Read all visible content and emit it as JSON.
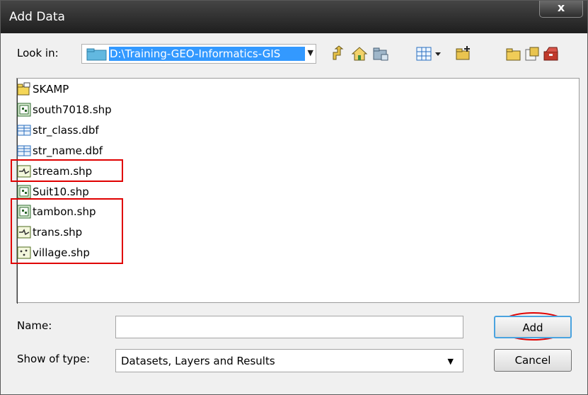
{
  "window": {
    "title": "Add Data",
    "close_label": "x"
  },
  "lookin": {
    "label": "Look in:",
    "path": "D:\\Training-GEO-Informatics-GIS"
  },
  "toolbar": [
    {
      "name": "up-one-level-icon"
    },
    {
      "name": "home-icon"
    },
    {
      "name": "connect-to-folder-icon"
    },
    {
      "name": "view-options-icon"
    },
    {
      "name": "new-item-icon"
    },
    {
      "name": "folder-icon"
    },
    {
      "name": "catalog-icon"
    },
    {
      "name": "toolbox-icon"
    }
  ],
  "files": [
    {
      "label": "SKAMP",
      "icon": "folder-icon"
    },
    {
      "label": "south7018.shp",
      "icon": "raster-icon"
    },
    {
      "label": "str_class.dbf",
      "icon": "table-icon"
    },
    {
      "label": "str_name.dbf",
      "icon": "table-icon"
    },
    {
      "label": "stream.shp",
      "icon": "line-feature-icon"
    },
    {
      "label": "Suit10.shp",
      "icon": "raster-icon"
    },
    {
      "label": "tambon.shp",
      "icon": "raster-icon"
    },
    {
      "label": "trans.shp",
      "icon": "line-feature-icon"
    },
    {
      "label": "village.shp",
      "icon": "point-feature-icon"
    }
  ],
  "form": {
    "name_label": "Name:",
    "name_value": "",
    "type_label": "Show of type:",
    "type_value": "Datasets, Layers and Results"
  },
  "buttons": {
    "add": "Add",
    "cancel": "Cancel"
  },
  "colors": {
    "highlight": "#e00000",
    "selection": "#3399ff"
  }
}
